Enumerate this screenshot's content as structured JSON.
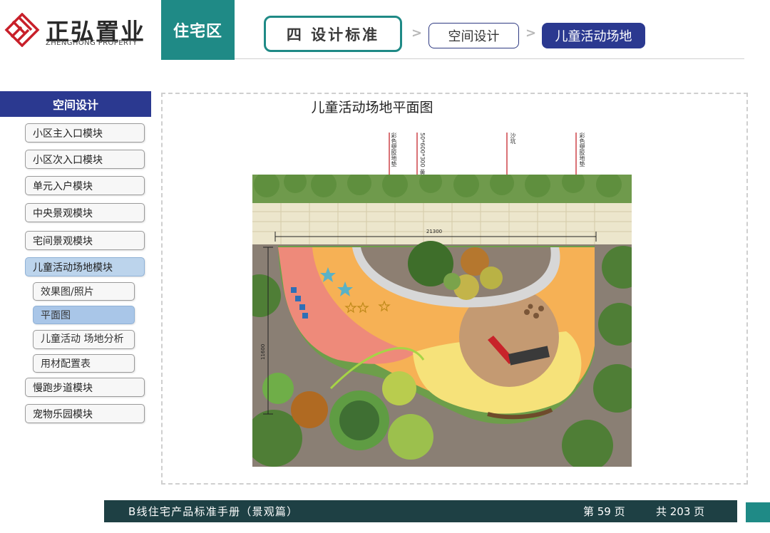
{
  "brand": {
    "name_cn": "正弘置业",
    "name_en": "ZHENGHONG PROPERTY",
    "color": "#c8202a"
  },
  "header": {
    "section_tab": "住宅区",
    "breadcrumb": [
      "四   设计标准",
      "空间设计",
      "儿童活动场地"
    ],
    "separator": ">",
    "accent": "#1f8a86",
    "active_color": "#2b3990"
  },
  "sidebar": {
    "title": "空间设计",
    "items": [
      "小区主入口模块",
      "小区次入口模块",
      "单元入户模块",
      "中央景观模块",
      "宅间景观模块",
      "儿童活动场地模块",
      "慢跑步道模块",
      "宠物乐园模块"
    ],
    "active_item": "儿童活动场地模块",
    "sub_items": [
      "效果图/照片",
      "平面图",
      "儿童活动 场地分析",
      "用材配置表"
    ],
    "active_sub_item": "平面图"
  },
  "main": {
    "title": "儿童活动场地平面图",
    "callouts": [
      "彩色塑胶地垫",
      "50*600*300 黄锈面黄金麻",
      "沙坑",
      "彩色塑胶地垫"
    ],
    "dim_width": "21300",
    "dim_height": "11600"
  },
  "footer": {
    "manual": "B线住宅产品标准手册（景观篇）",
    "page": "第  59  页",
    "total": "共 203 页"
  }
}
